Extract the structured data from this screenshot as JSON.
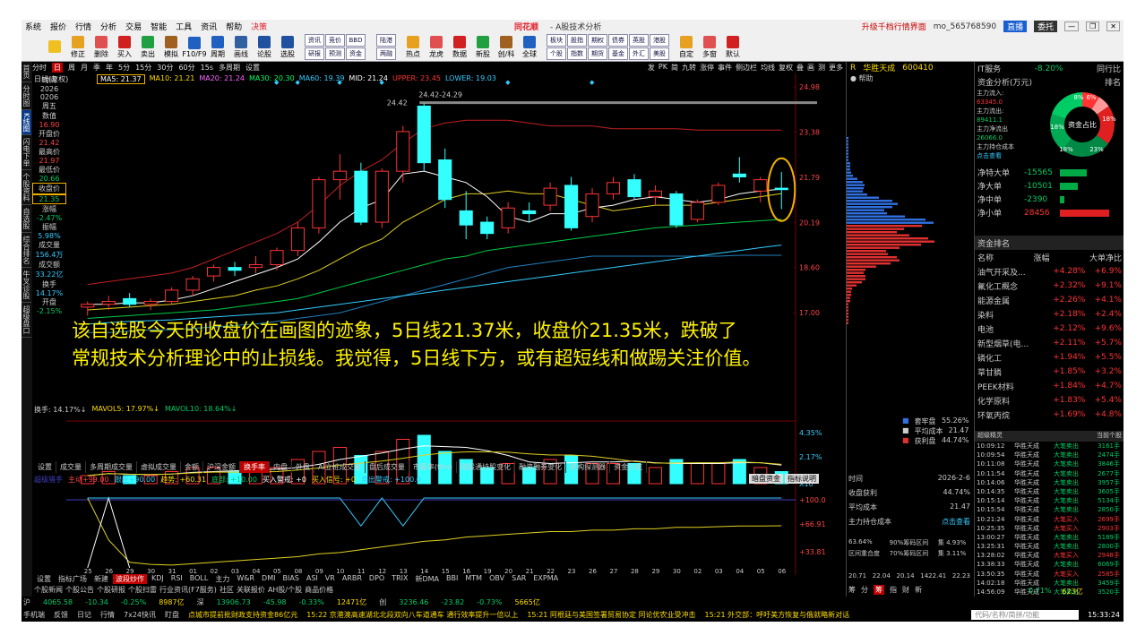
{
  "menu": {
    "items": [
      "系统",
      "报价",
      "行情",
      "分析",
      "交易",
      "智能",
      "工具",
      "资讯",
      "帮助",
      "决策"
    ],
    "brand": "同花顺",
    "title": "- A股技术分析",
    "upgrade": "升级千档行情界面",
    "user": "mo_565768590",
    "btn_direct": "直播",
    "btn_order": "委托"
  },
  "toolbar": {
    "buttons": [
      "修正",
      "删除",
      "买入",
      "卖出",
      "模拟",
      "F10/F9",
      "周期",
      "画线",
      "论股",
      "选股"
    ],
    "grid1": [
      "资讯",
      "竞价",
      "BBD",
      "研报",
      "预测",
      "资金"
    ],
    "grid2": [
      "陆港",
      "两融"
    ],
    "buttons2": [
      "热点",
      "龙虎",
      "数据",
      "新股",
      "创/科",
      "全球"
    ],
    "grid3": [
      "板块",
      "股指",
      "期权",
      "债券",
      "英股",
      "港股",
      "个股",
      "指数",
      "期货",
      "基金",
      "外汇",
      "美股"
    ],
    "buttons3": [
      "自定",
      "多窗",
      "默认"
    ]
  },
  "leftstrip": [
    "首页",
    "分时图",
    "K线图",
    "闪电下单",
    "个股资料",
    "自选股",
    "综合排名",
    "牛叉诊股",
    "超级盘口"
  ],
  "chartbar": [
    "分时",
    "日",
    "周",
    "月",
    "季",
    "年",
    "5分",
    "15分",
    "30分",
    "60分",
    "15s",
    "多周期",
    "设置"
  ],
  "chartbar_right": [
    "发",
    "PK",
    "简",
    "九转",
    "涨停",
    "事件",
    "侧边栏",
    "均线",
    "复权",
    "叠",
    "画",
    "测",
    "更多"
  ],
  "stock": {
    "code_label": "R",
    "name": "华胜天成",
    "code": "600410",
    "period": "日线(复权)"
  },
  "ma_legend": [
    {
      "label": "MA5: 21.37",
      "color": "#ffffff"
    },
    {
      "label": "MA10: 21.21",
      "color": "#ffdd00"
    },
    {
      "label": "MA20: 21.24",
      "color": "#ff66ff"
    },
    {
      "label": "MA30: 20.30",
      "color": "#00ff66"
    },
    {
      "label": "MA60: 19.39",
      "color": "#33ccff"
    },
    {
      "label": "MID: 21.24",
      "color": "#ffffff"
    },
    {
      "label": "UPPER: 23.45",
      "color": "#ff3333"
    },
    {
      "label": "LOWER: 19.03",
      "color": "#33ccff"
    }
  ],
  "info": {
    "time_label": "时间",
    "date": "2026",
    "md": "0206",
    "weekday": "周五",
    "value_label": "数值",
    "value": "16.90",
    "open_label": "开盘价",
    "open": "21.42",
    "high_label": "最高价",
    "high": "21.97",
    "low_label": "最低价",
    "low": "20.66",
    "close_label": "收盘价",
    "close": "21.35",
    "chg_label": "涨幅",
    "chg": "-2.47%",
    "amp_label": "振幅",
    "amp": "5.98%",
    "vol_label": "成交量",
    "vol": "156.4万",
    "amt_label": "成交额",
    "amt": "33.22亿",
    "turn_label": "换手",
    "turn": "14.17%",
    "open2_label": "开盘",
    "open2": "-2.15%"
  },
  "chart_data": {
    "type": "candlestick",
    "price_ticks": [
      "24.98",
      "23.38",
      "21.79",
      "20.19",
      "18.60",
      "17.00"
    ],
    "ylim": [
      16.5,
      25.2
    ],
    "annotations": [
      "24.42",
      "24.42-24.29"
    ],
    "dates": [
      "25",
      "26",
      "29",
      "30",
      "31",
      "01",
      "02",
      "03",
      "04",
      "05",
      "08",
      "09",
      "10",
      "11",
      "12",
      "13",
      "14",
      "15",
      "16",
      "19",
      "20",
      "21",
      "22",
      "23",
      "26",
      "27",
      "28",
      "29",
      "30",
      "02",
      "03",
      "04",
      "05",
      "06"
    ],
    "candles": [
      {
        "o": 17.2,
        "h": 17.4,
        "l": 16.9,
        "c": 17.3
      },
      {
        "o": 17.3,
        "h": 17.6,
        "l": 17.1,
        "c": 17.4
      },
      {
        "o": 17.5,
        "h": 17.7,
        "l": 17.2,
        "c": 17.3
      },
      {
        "o": 17.3,
        "h": 17.5,
        "l": 17.1,
        "c": 17.4
      },
      {
        "o": 17.4,
        "h": 17.9,
        "l": 17.3,
        "c": 17.8
      },
      {
        "o": 17.8,
        "h": 18.3,
        "l": 17.6,
        "c": 18.2
      },
      {
        "o": 18.3,
        "h": 18.7,
        "l": 18.1,
        "c": 18.6
      },
      {
        "o": 18.6,
        "h": 18.8,
        "l": 18.3,
        "c": 18.5
      },
      {
        "o": 18.6,
        "h": 19.0,
        "l": 18.4,
        "c": 18.7
      },
      {
        "o": 18.7,
        "h": 19.3,
        "l": 18.5,
        "c": 19.2
      },
      {
        "o": 19.2,
        "h": 20.2,
        "l": 19.0,
        "c": 20.0
      },
      {
        "o": 20.0,
        "h": 21.8,
        "l": 19.8,
        "c": 21.7
      },
      {
        "o": 21.7,
        "h": 22.6,
        "l": 21.0,
        "c": 22.0
      },
      {
        "o": 22.0,
        "h": 22.3,
        "l": 20.1,
        "c": 20.2
      },
      {
        "o": 20.2,
        "h": 22.1,
        "l": 20.0,
        "c": 22.0
      },
      {
        "o": 22.0,
        "h": 23.6,
        "l": 21.6,
        "c": 23.4
      },
      {
        "o": 24.3,
        "h": 24.4,
        "l": 22.0,
        "c": 22.3
      },
      {
        "o": 22.4,
        "h": 22.8,
        "l": 20.7,
        "c": 21.0
      },
      {
        "o": 20.6,
        "h": 21.3,
        "l": 19.6,
        "c": 20.1
      },
      {
        "o": 20.2,
        "h": 20.4,
        "l": 19.6,
        "c": 19.8
      },
      {
        "o": 20.0,
        "h": 20.9,
        "l": 19.8,
        "c": 20.7
      },
      {
        "o": 20.6,
        "h": 20.9,
        "l": 20.2,
        "c": 20.5
      },
      {
        "o": 20.8,
        "h": 21.6,
        "l": 20.6,
        "c": 21.4
      },
      {
        "o": 21.5,
        "h": 21.8,
        "l": 19.9,
        "c": 20.0
      },
      {
        "o": 20.4,
        "h": 21.4,
        "l": 20.2,
        "c": 21.2
      },
      {
        "o": 21.2,
        "h": 21.8,
        "l": 21.0,
        "c": 21.6
      },
      {
        "o": 21.7,
        "h": 21.9,
        "l": 21.0,
        "c": 21.1
      },
      {
        "o": 21.1,
        "h": 21.5,
        "l": 20.8,
        "c": 21.3
      },
      {
        "o": 21.2,
        "h": 21.3,
        "l": 20.0,
        "c": 20.1
      },
      {
        "o": 20.3,
        "h": 21.0,
        "l": 20.2,
        "c": 20.9
      },
      {
        "o": 20.9,
        "h": 21.6,
        "l": 20.8,
        "c": 21.5
      },
      {
        "o": 21.9,
        "h": 22.5,
        "l": 21.6,
        "c": 21.8
      },
      {
        "o": 21.3,
        "h": 21.8,
        "l": 20.9,
        "c": 21.7
      },
      {
        "o": 21.4,
        "h": 21.97,
        "l": 20.66,
        "c": 21.35
      }
    ],
    "ma5": [
      17.3,
      17.3,
      17.35,
      17.35,
      17.45,
      17.6,
      17.85,
      18.1,
      18.35,
      18.6,
      18.9,
      19.5,
      20.2,
      20.7,
      21.0,
      21.9,
      22.0,
      21.8,
      21.6,
      21.1,
      20.4,
      20.2,
      20.5,
      20.5,
      20.7,
      20.8,
      21.0,
      21.1,
      21.0,
      20.9,
      21.0,
      21.2,
      21.3,
      21.37
    ],
    "ma10": [
      17.1,
      17.15,
      17.2,
      17.25,
      17.3,
      17.4,
      17.5,
      17.6,
      17.8,
      17.95,
      18.2,
      18.5,
      18.9,
      19.3,
      19.6,
      20.2,
      20.6,
      21.0,
      21.2,
      21.2,
      21.3,
      21.2,
      21.2,
      21.0,
      20.8,
      20.6,
      20.7,
      20.8,
      20.8,
      20.8,
      20.9,
      21.0,
      21.1,
      21.21
    ],
    "ma30": [
      16.8,
      16.85,
      16.9,
      16.95,
      17.0,
      17.05,
      17.1,
      17.2,
      17.3,
      17.4,
      17.5,
      17.7,
      17.9,
      18.1,
      18.3,
      18.5,
      18.7,
      18.9,
      19.0,
      19.2,
      19.3,
      19.4,
      19.5,
      19.6,
      19.7,
      19.8,
      19.9,
      20.0,
      20.05,
      20.1,
      20.15,
      20.2,
      20.25,
      20.3
    ],
    "ma60": [
      16.6,
      16.65,
      16.7,
      16.72,
      16.75,
      16.8,
      16.85,
      16.9,
      16.95,
      17.0,
      17.1,
      17.2,
      17.3,
      17.4,
      17.5,
      17.6,
      17.7,
      17.8,
      17.9,
      18.0,
      18.1,
      18.2,
      18.3,
      18.4,
      18.5,
      18.6,
      18.7,
      18.8,
      18.9,
      19.0,
      19.1,
      19.2,
      19.3,
      19.39
    ],
    "upper": [
      18.0,
      18.1,
      18.2,
      18.3,
      18.4,
      18.6,
      18.9,
      19.2,
      19.5,
      19.8,
      20.2,
      20.8,
      21.5,
      22.0,
      22.4,
      23.0,
      23.5,
      23.7,
      23.8,
      23.8,
      23.8,
      23.7,
      23.6,
      23.6,
      23.6,
      23.5,
      23.5,
      23.5,
      23.5,
      23.45,
      23.45,
      23.45,
      23.45,
      23.45
    ],
    "lower": [
      16.3,
      16.3,
      16.35,
      16.4,
      16.4,
      16.45,
      16.5,
      16.55,
      16.6,
      16.7,
      16.8,
      16.9,
      17.0,
      17.2,
      17.4,
      17.6,
      17.8,
      18.0,
      18.2,
      18.4,
      18.6,
      18.7,
      18.8,
      18.9,
      19.0,
      19.0,
      19.0,
      19.0,
      19.0,
      19.0,
      19.0,
      19.03,
      19.03,
      19.03
    ],
    "volume": [
      2,
      3,
      2,
      2,
      3,
      4,
      4,
      3,
      3,
      4,
      6,
      8,
      9,
      7,
      8,
      11,
      12,
      8,
      6,
      4,
      5,
      4,
      6,
      7,
      5,
      5,
      5,
      4,
      6,
      5,
      5,
      6,
      4,
      3
    ],
    "vol_ticks": [
      "4.35%",
      "2.17%",
      "X10"
    ],
    "ind_ticks": [
      "+100.0",
      "+66.91",
      "+33.81"
    ]
  },
  "overlay_text": [
    "该自选股今天的收盘价在画图的迹象，5日线21.37米，收盘价21.35米，跌破了",
    "常规技术分析理论中的止损线。我觉得，5日线下方，或有超短线和做踢关注价值。"
  ],
  "vol_legend": [
    "换手: 14.17%↓",
    "MAVOL5: 17.97%↓",
    "MAVOL10: 18.64%↓"
  ],
  "tabs": [
    "设置",
    "成交量",
    "多周期成交量",
    "虚拟成交量",
    "金额",
    "沪深金额",
    "换手率",
    "内盘",
    "外盘",
    "AI立桩成交量",
    "盘后成交量",
    "市盈率(ttm)",
    "陆股通持股变化",
    "融资融券变化",
    "机构探测器",
    "资金抄底"
  ],
  "ind_legend": [
    "超级猎手",
    "主动+99.00",
    "跟庄+90.00",
    "趋势: +60.31",
    "底部: +10.00",
    "买入警戒: +0",
    "买入信号: +0",
    "卖出警戒: +100.0"
  ],
  "ind_btns": [
    "暗盘资金",
    "指标说明"
  ],
  "bottom_tabs": [
    "设置",
    "指标广场",
    "新建",
    "波段炒作",
    "KDJ",
    "RSI",
    "BOLL",
    "主力",
    "W&R",
    "DMI",
    "BIAS",
    "ASI",
    "VR",
    "ARBR",
    "DPO",
    "TRIX",
    "新DMA",
    "BBI",
    "MTM",
    "OBV",
    "SAR",
    "EXPMA"
  ],
  "bottom_tabs2": [
    "个股新闻",
    "个股公告",
    "个股研报",
    "个股扫雷",
    "行业资讯(F7服务)",
    "社区",
    "关联报价",
    "AH股/个股",
    "商品价格"
  ],
  "status": [
    "沪",
    "4065.58",
    "-10.34",
    "-0.25%",
    "8987亿",
    "深",
    "13906.73",
    "-45.98",
    "-0.33%",
    "12471亿",
    "创",
    "3236.46",
    "-23.82",
    "-0.73%",
    "5665亿"
  ],
  "news": [
    "手机端",
    "反馈",
    "日记",
    "行情",
    "7x24快讯",
    "盯盘",
    "点城市提前批财政支持资金86亿元",
    "15:22 京港澳高速湖北北段双向八车道通车 通行效率提升一倍以上",
    "15:21 阿根廷与美国签署贸易协定 同论优农业受冲击",
    "15:21 外交部：呼吁美方恢复与俄就略新对话",
    "代码/名称/简拼/功能",
    "15:33:24"
  ],
  "midpanel": {
    "header": "华胜天成",
    "help": "帮助",
    "tabs": [
      "筹",
      "分",
      "筹",
      "指",
      "财",
      "新"
    ],
    "chip_rows": [
      [
        "时间",
        "2026-2-6"
      ],
      [
        "收盘获利",
        "44.74%"
      ],
      [
        "平均成本",
        "21.47"
      ],
      [
        "主力持仓成本",
        "点击查看"
      ]
    ],
    "legend": [
      [
        "套牢盘",
        "55.26%"
      ],
      [
        "平均成本",
        "21.47"
      ],
      [
        "获利盘",
        "44.74%"
      ]
    ],
    "conc": [
      "63.64%",
      "90%筹码区间",
      "集 4.93%",
      "区间重合度",
      "70%筹码区间",
      "集 3.11%"
    ],
    "range": [
      "20.71",
      "22.04",
      "20.14",
      "1422.41",
      "22.23"
    ]
  },
  "right": {
    "it_service": "IT服务",
    "it_chg": "-8.20%",
    "peer": "同行比",
    "fund_title": "资金分析(万元)",
    "rank": "排名",
    "inflow": "主力流入:",
    "inflow_v": "63345.0",
    "outflow": "主力流出:",
    "outflow_v": "89411.1",
    "net": "主力净流出",
    "net_v": "26066.0",
    "cost": "主力持仓成本",
    "cost_link": "点击查看",
    "donut": [
      "8%",
      "6%",
      "18%",
      "18%",
      "23%",
      "18%"
    ],
    "donut_center": "资金占比",
    "flows": [
      [
        "净特大单",
        "-15565"
      ],
      [
        "净大单",
        "-10501"
      ],
      [
        "净中单",
        "-2390"
      ],
      [
        "净小单",
        "28456"
      ]
    ],
    "sector_title": "资金排名",
    "sector_hdr": [
      "名称",
      "涨幅",
      "大单净比"
    ],
    "sectors": [
      [
        "油气开采及...",
        "+4.28%",
        "+6.9%"
      ],
      [
        "氟化工概念",
        "+2.32%",
        "+9.1%"
      ],
      [
        "能源金属",
        "+2.26%",
        "+4.1%"
      ],
      [
        "染料",
        "+2.18%",
        "+2.4%"
      ],
      [
        "电池",
        "+2.12%",
        "+9.6%"
      ],
      [
        "新型烟草(电...",
        "+2.11%",
        "+5.7%"
      ],
      [
        "磷化工",
        "+1.94%",
        "+5.5%"
      ],
      [
        "草甘膦",
        "+1.85%",
        "+3.2%"
      ],
      [
        "PEEK材料",
        "+1.84%",
        "+4.7%"
      ],
      [
        "化学原料",
        "+1.83%",
        "+5.4%"
      ],
      [
        "环氧丙烷",
        "+1.69%",
        "+4.8%"
      ]
    ],
    "ticker_title": "超级精灵",
    "ticker_right": "当前个股",
    "ticks": [
      [
        "10:09:12",
        "华胜天成",
        "大笔卖出",
        "3161手"
      ],
      [
        "10:09:54",
        "华胜天成",
        "大笔卖出",
        "2474手"
      ],
      [
        "10:11:08",
        "华胜天成",
        "大笔卖出",
        "3846手"
      ],
      [
        "10:11:54",
        "华胜天成",
        "大笔卖出",
        "2677手"
      ],
      [
        "10:14:06",
        "华胜天成",
        "大笔卖出",
        "3957手"
      ],
      [
        "10:14:35",
        "华胜天成",
        "大笔卖出",
        "3605手"
      ],
      [
        "10:15:14",
        "华胜天成",
        "大笔卖出",
        "5134手"
      ],
      [
        "10:15:54",
        "华胜天成",
        "大笔卖出",
        "2850手"
      ],
      [
        "10:21:24",
        "华胜天成",
        "大笔买入",
        "2699手"
      ],
      [
        "10:25:35",
        "华胜天成",
        "大笔买入",
        "2903手"
      ],
      [
        "13:00:27",
        "华胜天成",
        "大笔卖出",
        "5189手"
      ],
      [
        "13:25:31",
        "华胜天成",
        "大笔卖出",
        "2800手"
      ],
      [
        "13:28:02",
        "华胜天成",
        "大笔买入",
        "2948手"
      ],
      [
        "13:38:33",
        "华胜天成",
        "大笔卖出",
        "6069手"
      ],
      [
        "13:50:35",
        "华胜天成",
        "大笔买入",
        "2585手"
      ],
      [
        "14:02:18",
        "华胜天成",
        "大笔卖出",
        "3459手"
      ],
      [
        "14:56:09",
        "华胜天成",
        "大笔卖出",
        "3520手"
      ],
      [
        "15:02:12",
        "华胜天成",
        "大笔卖出",
        "3599手"
      ],
      [
        "15:24:24",
        "华胜天成",
        "大笔卖出",
        "3145手"
      ]
    ],
    "foot_pct": "0.71%",
    "foot_amt": "623亿"
  }
}
